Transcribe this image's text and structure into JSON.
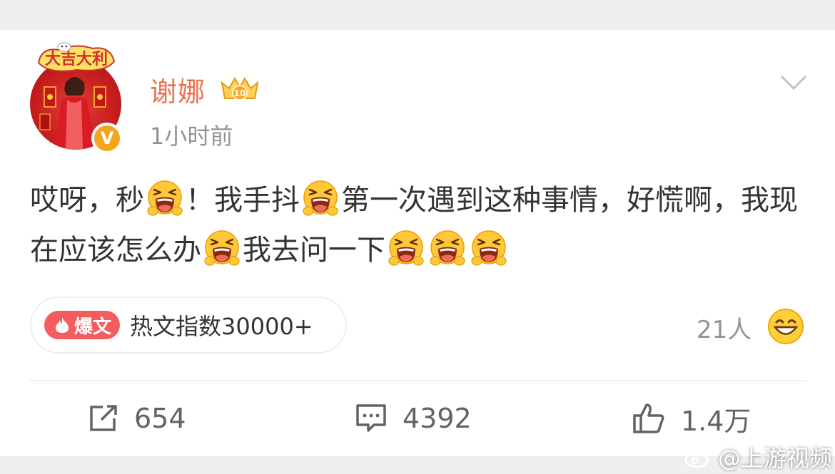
{
  "post": {
    "author": {
      "name": "谢娜",
      "avatar_caption": "大吉大利"
    },
    "time": "1小时前",
    "content": [
      {
        "t": "text",
        "v": "哎呀，秒"
      },
      {
        "t": "emoji"
      },
      {
        "t": "text",
        "v": "！我手抖"
      },
      {
        "t": "emoji"
      },
      {
        "t": "text",
        "v": "第一次遇到这种事情，好慌啊，我现在应该怎么办"
      },
      {
        "t": "emoji"
      },
      {
        "t": "text",
        "v": "我去问一下"
      },
      {
        "t": "emoji"
      },
      {
        "t": "emoji"
      },
      {
        "t": "emoji"
      }
    ],
    "hot": {
      "badge": "爆文",
      "text": "热文指数30000+"
    },
    "reactions": {
      "count": "21人"
    }
  },
  "actions": {
    "repost": "654",
    "comment": "4392",
    "like": "1.4万"
  },
  "watermark": {
    "text": "@上游视频"
  },
  "colors": {
    "username": "#eb7350",
    "hot_badge": "#f35d5d",
    "text": "#333333",
    "muted": "#939393"
  }
}
